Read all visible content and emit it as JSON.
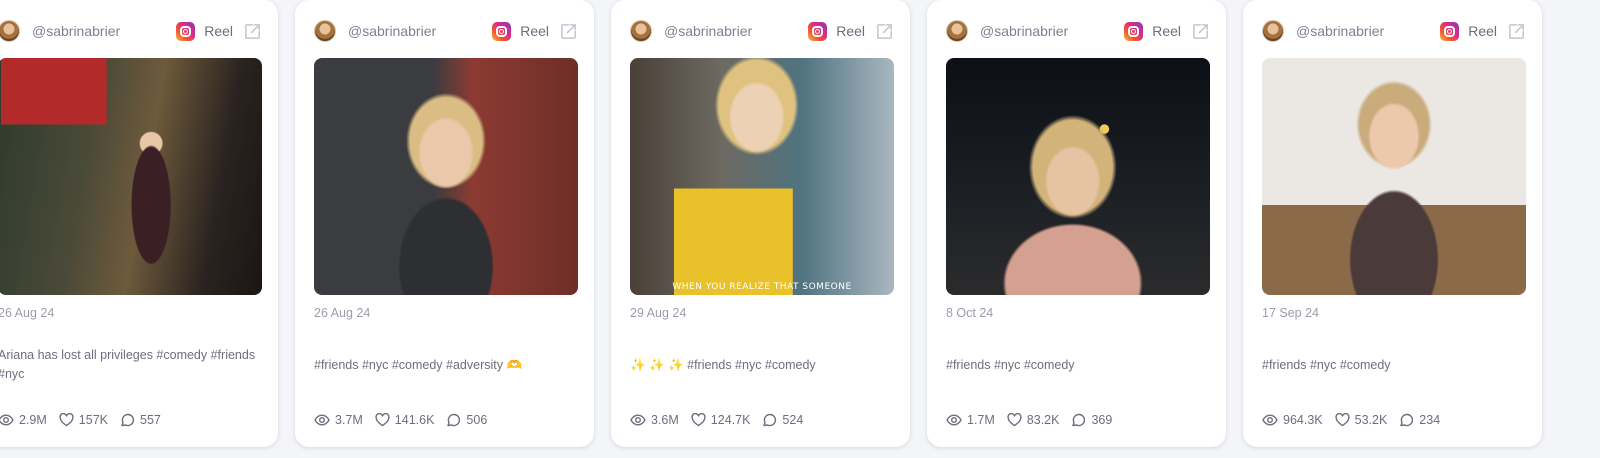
{
  "posts": [
    {
      "handle": "@sabrinabrier",
      "platform_icon": "instagram-icon",
      "type": "Reel",
      "media_overlay_text": "",
      "date": "26 Aug 24",
      "caption": "Ariana has lost all privileges #comedy #friends #nyc",
      "views": "2.9M",
      "likes": "157K",
      "comments": "557"
    },
    {
      "handle": "@sabrinabrier",
      "platform_icon": "instagram-icon",
      "type": "Reel",
      "media_overlay_text": "",
      "date": "26 Aug 24",
      "caption": "#friends #nyc #comedy #adversity 🫶",
      "views": "3.7M",
      "likes": "141.6K",
      "comments": "506"
    },
    {
      "handle": "@sabrinabrier",
      "platform_icon": "instagram-icon",
      "type": "Reel",
      "media_overlay_text": "WHEN YOU REALIZE THAT SOMEONE",
      "date": "29 Aug 24",
      "caption": "✨ ✨ ✨ #friends #nyc #comedy",
      "views": "3.6M",
      "likes": "124.7K",
      "comments": "524"
    },
    {
      "handle": "@sabrinabrier",
      "platform_icon": "instagram-icon",
      "type": "Reel",
      "media_overlay_text": "",
      "date": "8 Oct 24",
      "caption": "#friends #nyc #comedy",
      "views": "1.7M",
      "likes": "83.2K",
      "comments": "369"
    },
    {
      "handle": "@sabrinabrier",
      "platform_icon": "instagram-icon",
      "type": "Reel",
      "media_overlay_text": "",
      "date": "17 Sep 24",
      "caption": "#friends #nyc #comedy",
      "views": "964.3K",
      "likes": "53.2K",
      "comments": "234"
    }
  ],
  "icons": {
    "views": "eye-icon",
    "likes": "heart-icon",
    "comments": "comment-icon",
    "open": "external-link-icon"
  },
  "colors": {
    "card_bg": "#ffffff",
    "page_bg": "#f4f5f8",
    "text": "#6b6f7d",
    "muted": "#9a9eaa"
  }
}
